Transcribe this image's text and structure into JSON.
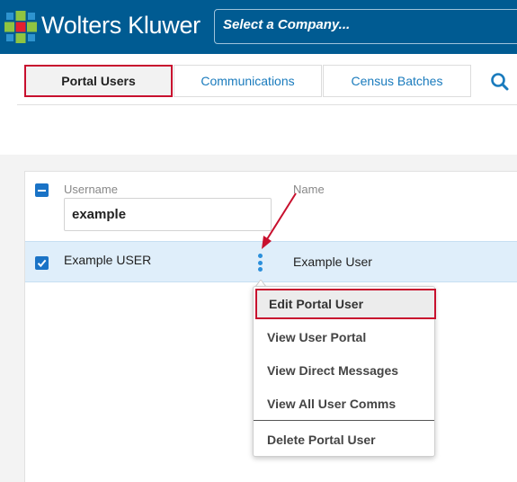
{
  "header": {
    "brand": "Wolters Kluwer",
    "company_select_placeholder": "Select a Company..."
  },
  "tabs": [
    {
      "label": "Portal Users",
      "active": true
    },
    {
      "label": "Communications",
      "active": false
    },
    {
      "label": "Census Batches",
      "active": false
    }
  ],
  "grid": {
    "columns": {
      "username": "Username",
      "name": "Name"
    },
    "username_filter_value": "example",
    "rows": [
      {
        "username": "Example USER",
        "name": "Example User",
        "selected": true
      }
    ]
  },
  "context_menu": {
    "items": [
      "Edit Portal User",
      "View User Portal",
      "View Direct Messages",
      "View All User Comms",
      "Delete Portal User"
    ]
  },
  "colors": {
    "header_bg": "#005b92",
    "accent_blue": "#1a7bbd",
    "highlight_red": "#c8102e",
    "row_selected": "#dfeefa"
  },
  "icons": [
    "wolters-kluwer-logo",
    "search-icon",
    "kebab-menu-icon",
    "checkbox-icon"
  ]
}
